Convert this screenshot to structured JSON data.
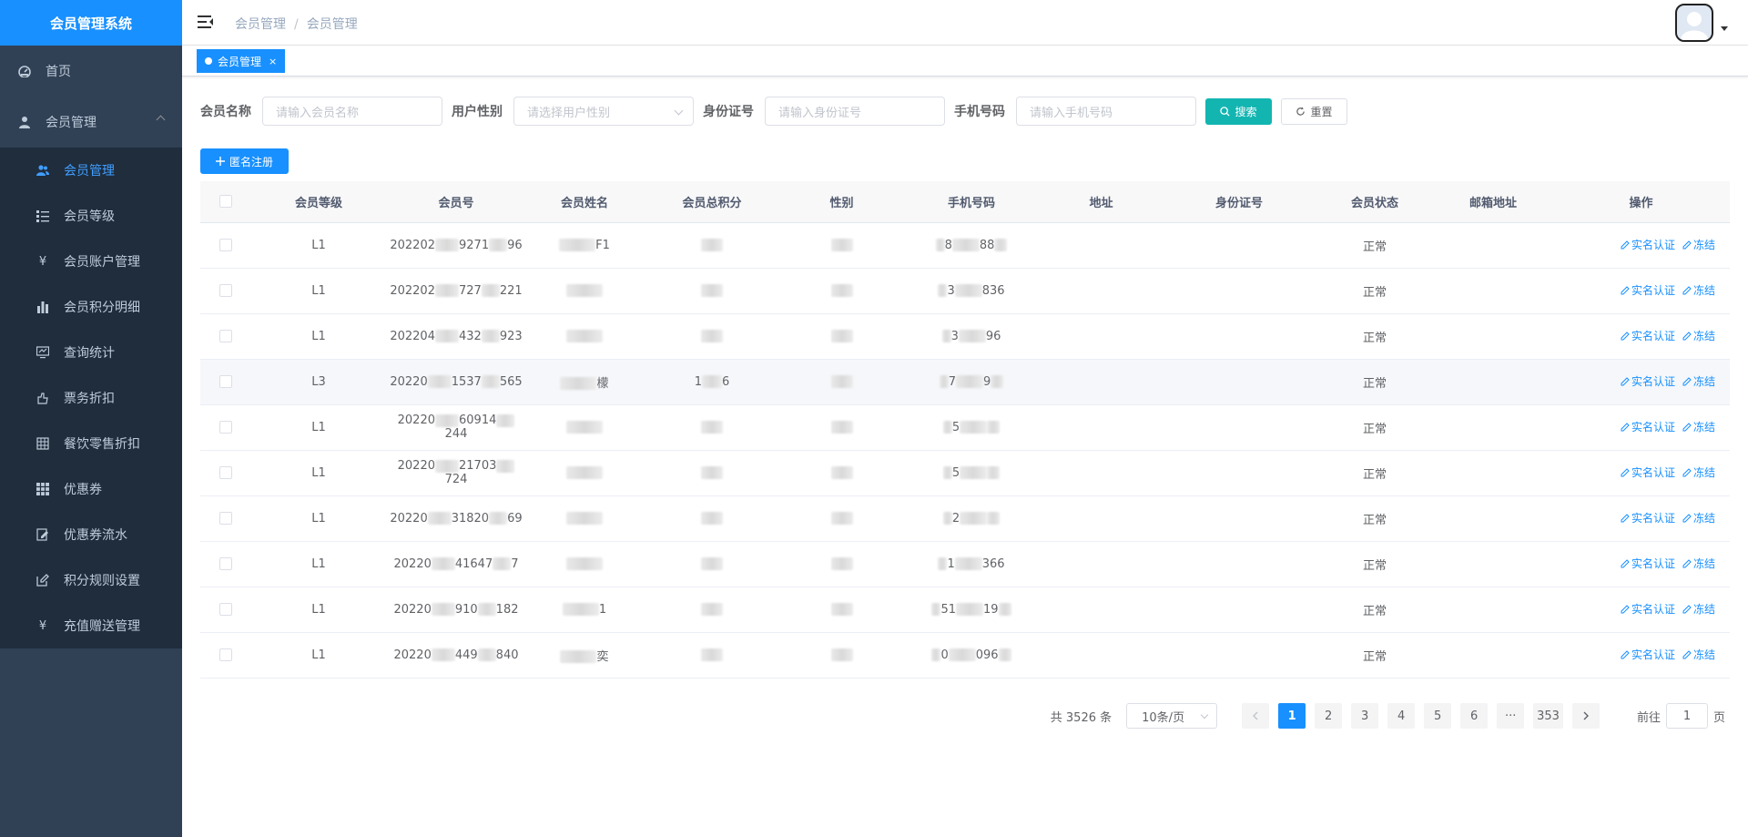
{
  "app": {
    "title": "会员管理系统"
  },
  "sidebar": {
    "home": "首页",
    "group": "会员管理",
    "items": [
      {
        "label": "会员管理",
        "icon": "users-icon",
        "active": true
      },
      {
        "label": "会员等级",
        "icon": "list-icon"
      },
      {
        "label": "会员账户管理",
        "icon": "yen-icon"
      },
      {
        "label": "会员积分明细",
        "icon": "bar-chart-icon"
      },
      {
        "label": "查询统计",
        "icon": "monitor-icon"
      },
      {
        "label": "票务折扣",
        "icon": "hand-icon"
      },
      {
        "label": "餐饮零售折扣",
        "icon": "grid-icon"
      },
      {
        "label": "优惠券",
        "icon": "table-icon"
      },
      {
        "label": "优惠券流水",
        "icon": "edit-doc-icon"
      },
      {
        "label": "积分规则设置",
        "icon": "edit-icon"
      },
      {
        "label": "充值赠送管理",
        "icon": "yen-icon"
      }
    ]
  },
  "breadcrumb": {
    "first": "会员管理",
    "second": "会员管理"
  },
  "tags": {
    "active": "会员管理",
    "close": "×"
  },
  "search": {
    "name_label": "会员名称",
    "name_placeholder": "请输入会员名称",
    "gender_label": "用户性别",
    "gender_placeholder": "请选择用户性别",
    "id_label": "身份证号",
    "id_placeholder": "请输入身份证号",
    "phone_label": "手机号码",
    "phone_placeholder": "请输入手机号码",
    "search_btn": "搜索",
    "reset_btn": "重置"
  },
  "toolbar": {
    "register_btn": "匿名注册"
  },
  "table": {
    "headers": [
      "会员等级",
      "会员号",
      "会员姓名",
      "会员总积分",
      "性别",
      "手机号码",
      "地址",
      "身份证号",
      "会员状态",
      "邮箱地址",
      "操作"
    ],
    "op_verify": "实名认证",
    "op_freeze": "冻结",
    "rows": [
      {
        "level": "L1",
        "no_a": "202202",
        "no_b": "9271",
        "no_c": "96",
        "name": "F1",
        "points": "",
        "phone_a": "8",
        "phone_b": "88",
        "status": "正常"
      },
      {
        "level": "L1",
        "no_a": "202202",
        "no_b": "727",
        "no_c": "221",
        "name": "",
        "points": "",
        "phone_a": "3",
        "phone_b": "8",
        "phone_c": "36",
        "status": "正常"
      },
      {
        "level": "L1",
        "no_a": "202204",
        "no_b": "432",
        "no_c": "923",
        "name": "",
        "points": "",
        "phone_a": "3",
        "phone_b": "9",
        "phone_c": "6",
        "status": "正常"
      },
      {
        "level": "L3",
        "no_a": "20220",
        "no_b": "1537",
        "no_c": "565",
        "name": "檬",
        "points_a": "1",
        "points_b": "6",
        "phone_a": "7",
        "phone_b": "9",
        "status": "正常"
      },
      {
        "level": "L1",
        "no_a": "20220",
        "no_b": "60914",
        "no_c": "244",
        "name": "",
        "points": "",
        "phone_a": "5",
        "phone_b": "",
        "status": "正常"
      },
      {
        "level": "L1",
        "no_a": "20220",
        "no_b": "21703",
        "no_c": "724",
        "name": "",
        "points": "",
        "phone_a": "5",
        "phone_b": "",
        "status": "正常"
      },
      {
        "level": "L1",
        "no_a": "20220",
        "no_b": "31820",
        "no_c": "69",
        "name": "",
        "points": "",
        "phone_a": "2",
        "phone_b": "",
        "status": "正常"
      },
      {
        "level": "L1",
        "no_a": "20220",
        "no_b": "41647",
        "no_c": "7",
        "name": "",
        "points": "",
        "phone_a": "1",
        "phone_b": "36",
        "phone_c": "6",
        "status": "正常"
      },
      {
        "level": "L1",
        "no_a": "20220",
        "no_b": "910",
        "no_c": "182",
        "name": "1",
        "points": "",
        "phone_a": "51",
        "phone_b": "19",
        "status": "正常"
      },
      {
        "level": "L1",
        "no_a": "20220",
        "no_b": "449",
        "no_c": "840",
        "name": "奕",
        "points": "",
        "phone_a": "0",
        "phone_b": "096",
        "status": "正常"
      }
    ]
  },
  "pagination": {
    "total": "共 3526 条",
    "page_size": "10条/页",
    "pages": [
      "1",
      "2",
      "3",
      "4",
      "5",
      "6"
    ],
    "ellipsis": "···",
    "last": "353",
    "goto_prefix": "前往",
    "goto_value": "1",
    "goto_suffix": "页"
  },
  "colors": {
    "sidebar_bg": "#304156",
    "submenu_bg": "#1f2d3d",
    "brand": "#1890ff",
    "search_btn": "#13b5b1",
    "active_text": "#409eff"
  }
}
